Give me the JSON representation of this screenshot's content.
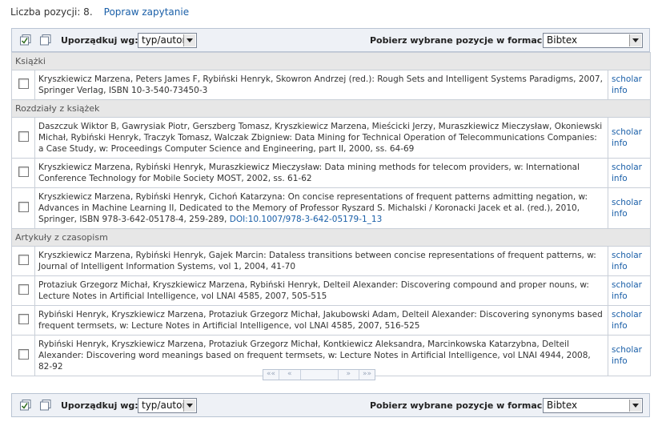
{
  "count_label": "Liczba pozycji: 8.",
  "refine_link": "Popraw zapytanie",
  "toolbar": {
    "sort_label": "Uporządkuj wg:",
    "sort_value": "typ/autor",
    "export_label": "Pobierz wybrane pozycje w formacie:",
    "export_value": "Bibtex"
  },
  "sections": [
    {
      "title": "Książki",
      "items": [
        {
          "text": "Kryszkiewicz Marzena, Peters James F, Rybiński Henryk, Skowron Andrzej (red.): Rough Sets and Intelligent Systems Paradigms, 2007, Springer Verlag, ISBN 10-3-540-73450-3",
          "doi": ""
        }
      ]
    },
    {
      "title": "Rozdziały z książek",
      "items": [
        {
          "text": "Daszczuk Wiktor B, Gawrysiak Piotr, Gerszberg Tomasz, Kryszkiewicz Marzena, Mieścicki Jerzy, Muraszkiewicz Mieczysław, Okoniewski Michał, Rybiński Henryk, Traczyk Tomasz, Walczak Zbigniew: Data Mining for Technical Operation of Telecommunications Companies: a Case Study, w: Proceedings Computer Science and Engineering, part II, 2000, ss. 64-69",
          "doi": ""
        },
        {
          "text": "Kryszkiewicz Marzena, Rybiński Henryk, Muraszkiewicz Mieczysław: Data mining methods for telecom providers, w: International Conference Technology for Mobile Society MOST, 2002, ss. 61-62",
          "doi": ""
        },
        {
          "text": "Kryszkiewicz Marzena, Rybiński Henryk, Cichoń Katarzyna: On concise representations of frequent patterns admitting negation, w: Advances in Machine Learning II, Dedicated to the Memory of Professor Ryszard S. Michalski / Koronacki Jacek et al. (red.), 2010, Springer, ISBN 978-3-642-05178-4, 259-289,",
          "doi": "DOI:10.1007/978-3-642-05179-1_13"
        }
      ]
    },
    {
      "title": "Artykuły z czasopism",
      "items": [
        {
          "text": "Kryszkiewicz Marzena, Rybiński Henryk, Gajek Marcin: Dataless transitions between concise representations of frequent patterns, w: Journal of Intelligent Information Systems, vol 1, 2004, 41-70",
          "doi": ""
        },
        {
          "text": "Protaziuk Grzegorz Michał, Kryszkiewicz Marzena, Rybiński Henryk, Delteil Alexander: Discovering compound and proper nouns, w: Lecture Notes in Artificial Intelligence, vol LNAI 4585, 2007, 505-515",
          "doi": ""
        },
        {
          "text": "Rybiński Henryk, Kryszkiewicz Marzena, Protaziuk Grzegorz Michał, Jakubowski Adam, Delteil Alexander: Discovering synonyms based frequent termsets, w: Lecture Notes in Artificial Intelligence, vol LNAI 4585, 2007, 516-525",
          "doi": ""
        },
        {
          "text": "Rybiński Henryk, Kryszkiewicz Marzena, Protaziuk Grzegorz Michał, Kontkiewicz Aleksandra, Marcinkowska Katarzybna, Delteil Alexander: Discovering word meanings based on frequent termsets, w: Lecture Notes in Artificial Intelligence, vol LNAI 4944, 2008, 82-92",
          "doi": ""
        }
      ]
    }
  ],
  "link_scholar": "scholar",
  "link_info": "info",
  "pager": [
    "««",
    "«",
    "",
    "»",
    "»»"
  ]
}
